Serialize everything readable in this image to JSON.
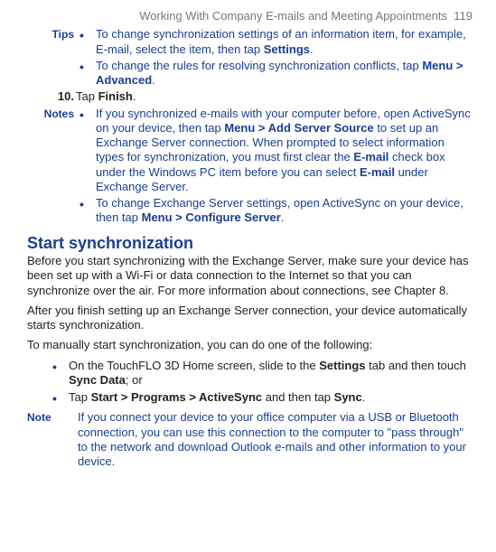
{
  "header": {
    "title": "Working With Company E-mails and Meeting Appointments",
    "page": "119"
  },
  "tips": {
    "label": "Tips",
    "item1a": "To change synchronization settings of an information item, for example, E-mail, select the item, then tap ",
    "item1b": "Settings",
    "item1c": ".",
    "item2a": "To change the rules for resolving synchronization conflicts, tap ",
    "item2b": "Menu > Advanced",
    "item2c": "."
  },
  "step10": {
    "num": "10.",
    "a": "Tap ",
    "b": "Finish",
    "c": "."
  },
  "notes": {
    "label": "Notes",
    "n1a": "If you synchronized e-mails with your computer before, open ActiveSync on your device, then tap ",
    "n1b": "Menu > Add Server Source",
    "n1c": " to set up an Exchange Server connection. When prompted to select information types for synchronization, you must first clear the ",
    "n1d": "E-mail",
    "n1e": " check box under the Windows PC item before you can select ",
    "n1f": "E-mail",
    "n1g": " under Exchange Server.",
    "n2a": "To change Exchange Server settings, open ActiveSync on your device, then tap ",
    "n2b": "Menu > Configure Server",
    "n2c": "."
  },
  "section_title": "Start synchronization",
  "para1": "Before you start synchronizing with the Exchange Server, make sure your device has been set up with a Wi-Fi or data connection to the Internet so that you can synchronize over the air. For more information about connections, see Chapter 8.",
  "para2": "After you finish setting up an Exchange Server connection, your device automatically starts synchronization.",
  "para3": "To manually start synchronization, you can do one of the following:",
  "list1a": "On the TouchFLO 3D Home screen, slide to the ",
  "list1b": "Settings",
  "list1c": " tab and then touch ",
  "list1d": "Sync Data",
  "list1e": "; or",
  "list2a": "Tap ",
  "list2b": "Start > Programs > ActiveSync",
  "list2c": " and then tap ",
  "list2d": "Sync",
  "list2e": ".",
  "note_final": {
    "label": "Note",
    "text": "If you connect your device to your office computer via a USB or Bluetooth connection, you can use this connection to the computer to \"pass through\" to the network and download Outlook e-mails and other information to your device."
  }
}
